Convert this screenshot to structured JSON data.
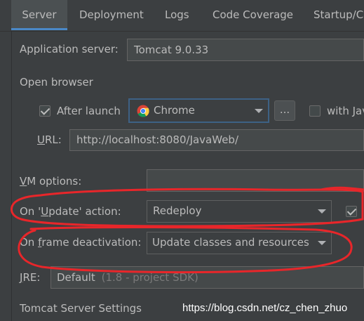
{
  "tabs": [
    {
      "label": "Server"
    },
    {
      "label": "Deployment"
    },
    {
      "label": "Logs"
    },
    {
      "label": "Code Coverage"
    },
    {
      "label": "Startup/C"
    }
  ],
  "application_server": {
    "label": "Application server:",
    "value": "Tomcat 9.0.33"
  },
  "open_browser": {
    "section_label": "Open browser",
    "after_launch_label": "After launch",
    "after_launch_checked": true,
    "browser_value": "Chrome",
    "browse_button_label": "...",
    "with_js_label": "with Jav",
    "with_js_checked": false
  },
  "url": {
    "label": "URL:",
    "value": "http://localhost:8080/JavaWeb/"
  },
  "vm_options": {
    "label": "VM options:",
    "value": ""
  },
  "on_update": {
    "label": "On 'Update' action:",
    "value": "Redeploy",
    "checkbox_checked": true
  },
  "on_frame": {
    "label": "On frame deactivation:",
    "value": "Update classes and resources"
  },
  "jre": {
    "label": "JRE:",
    "value": "Default",
    "hint": "(1.8 - project SDK)"
  },
  "tomcat_settings_label": "Tomcat Server Settings",
  "watermark": "https://blog.csdn.net/cz_chen_zhuo",
  "colors": {
    "annotation": "#e8262a",
    "focus": "#3d6185",
    "accent": "#4a88c7"
  }
}
